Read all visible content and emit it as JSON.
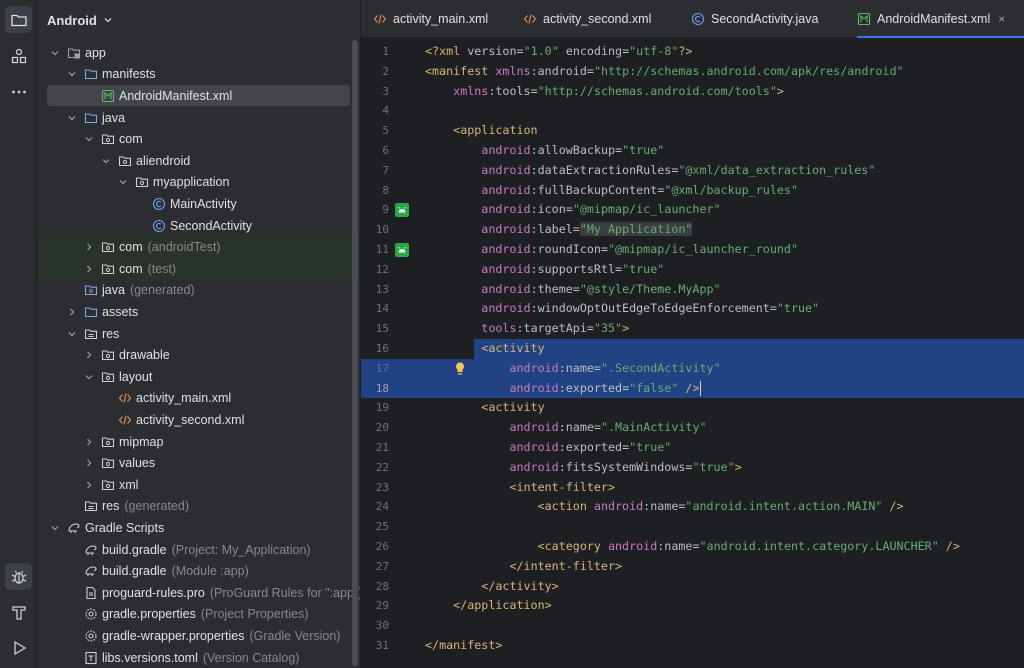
{
  "sidebar": {
    "header_title": "Android",
    "tree": [
      {
        "label": "app",
        "hint": "",
        "depth": 0,
        "arrow": "down",
        "icon": "module-folder-icon"
      },
      {
        "label": "manifests",
        "hint": "",
        "depth": 1,
        "arrow": "down",
        "icon": "folder-icon"
      },
      {
        "label": "AndroidManifest.xml",
        "hint": "",
        "depth": 2,
        "arrow": "none",
        "icon": "manifest-file-icon",
        "selected": true
      },
      {
        "label": "java",
        "hint": "",
        "depth": 1,
        "arrow": "down",
        "icon": "folder-icon"
      },
      {
        "label": "com",
        "hint": "",
        "depth": 2,
        "arrow": "down",
        "icon": "package-icon"
      },
      {
        "label": "aliendroid",
        "hint": "",
        "depth": 3,
        "arrow": "down",
        "icon": "package-icon"
      },
      {
        "label": "myapplication",
        "hint": "",
        "depth": 4,
        "arrow": "down",
        "icon": "package-icon"
      },
      {
        "label": "MainActivity",
        "hint": "",
        "depth": 5,
        "arrow": "none",
        "icon": "class-icon"
      },
      {
        "label": "SecondActivity",
        "hint": "",
        "depth": 5,
        "arrow": "none",
        "icon": "class-icon"
      },
      {
        "label": "com",
        "hint": "(androidTest)",
        "depth": 2,
        "arrow": "right",
        "icon": "package-icon",
        "test": true
      },
      {
        "label": "com",
        "hint": "(test)",
        "depth": 2,
        "arrow": "right",
        "icon": "package-icon",
        "test": true
      },
      {
        "label": "java",
        "hint": "(generated)",
        "depth": 1,
        "arrow": "none",
        "icon": "generated-folder-icon"
      },
      {
        "label": "assets",
        "hint": "",
        "depth": 1,
        "arrow": "right",
        "icon": "folder-icon"
      },
      {
        "label": "res",
        "hint": "",
        "depth": 1,
        "arrow": "down",
        "icon": "res-folder-icon"
      },
      {
        "label": "drawable",
        "hint": "",
        "depth": 2,
        "arrow": "right",
        "icon": "package-icon"
      },
      {
        "label": "layout",
        "hint": "",
        "depth": 2,
        "arrow": "down",
        "icon": "package-icon"
      },
      {
        "label": "activity_main.xml",
        "hint": "",
        "depth": 3,
        "arrow": "none",
        "icon": "xml-file-icon"
      },
      {
        "label": "activity_second.xml",
        "hint": "",
        "depth": 3,
        "arrow": "none",
        "icon": "xml-file-icon"
      },
      {
        "label": "mipmap",
        "hint": "",
        "depth": 2,
        "arrow": "right",
        "icon": "package-icon"
      },
      {
        "label": "values",
        "hint": "",
        "depth": 2,
        "arrow": "right",
        "icon": "package-icon"
      },
      {
        "label": "xml",
        "hint": "",
        "depth": 2,
        "arrow": "right",
        "icon": "package-icon"
      },
      {
        "label": "res",
        "hint": "(generated)",
        "depth": 1,
        "arrow": "none",
        "icon": "res-folder-icon"
      },
      {
        "label": "Gradle Scripts",
        "hint": "",
        "depth": 0,
        "arrow": "down",
        "icon": "gradle-icon"
      },
      {
        "label": "build.gradle",
        "hint": "(Project: My_Application)",
        "depth": 1,
        "arrow": "none",
        "icon": "gradle-icon"
      },
      {
        "label": "build.gradle",
        "hint": "(Module :app)",
        "depth": 1,
        "arrow": "none",
        "icon": "gradle-icon"
      },
      {
        "label": "proguard-rules.pro",
        "hint": "(ProGuard Rules for \":app\")",
        "depth": 1,
        "arrow": "none",
        "icon": "file-icon"
      },
      {
        "label": "gradle.properties",
        "hint": "(Project Properties)",
        "depth": 1,
        "arrow": "none",
        "icon": "settings-file-icon"
      },
      {
        "label": "gradle-wrapper.properties",
        "hint": "(Gradle Version)",
        "depth": 1,
        "arrow": "none",
        "icon": "settings-file-icon"
      },
      {
        "label": "libs.versions.toml",
        "hint": "(Version Catalog)",
        "depth": 1,
        "arrow": "none",
        "icon": "toml-file-icon"
      }
    ]
  },
  "editor": {
    "tabs": [
      {
        "label": "activity_main.xml",
        "icon": "xml-file-icon",
        "active": false
      },
      {
        "label": "activity_second.xml",
        "icon": "xml-file-icon",
        "active": false
      },
      {
        "label": "SecondActivity.java",
        "icon": "class-icon",
        "active": false
      },
      {
        "label": "AndroidManifest.xml",
        "icon": "manifest-file-icon",
        "active": true,
        "close": "×"
      }
    ],
    "current_line": 18,
    "lines": [
      {
        "n": "1",
        "text": "<?xml version=\"1.0\" encoding=\"utf-8\"?>"
      },
      {
        "n": "2",
        "text": "<manifest xmlns:android=\"http://schemas.android.com/apk/res/android\""
      },
      {
        "n": "3",
        "text": "    xmlns:tools=\"http://schemas.android.com/tools\">"
      },
      {
        "n": "4",
        "text": ""
      },
      {
        "n": "5",
        "text": "    <application"
      },
      {
        "n": "6",
        "text": "        android:allowBackup=\"true\""
      },
      {
        "n": "7",
        "text": "        android:dataExtractionRules=\"@xml/data_extraction_rules\""
      },
      {
        "n": "8",
        "text": "        android:fullBackupContent=\"@xml/backup_rules\""
      },
      {
        "n": "9",
        "text": "        android:icon=\"@mipmap/ic_launcher\"",
        "gutter": "android-icon"
      },
      {
        "n": "10",
        "text": "        android:label=\"My Application\""
      },
      {
        "n": "11",
        "text": "        android:roundIcon=\"@mipmap/ic_launcher_round\"",
        "gutter": "android-icon"
      },
      {
        "n": "12",
        "text": "        android:supportsRtl=\"true\""
      },
      {
        "n": "13",
        "text": "        android:theme=\"@style/Theme.MyApp\""
      },
      {
        "n": "14",
        "text": "        android:windowOptOutEdgeToEdgeEnforcement=\"true\""
      },
      {
        "n": "15",
        "text": "        tools:targetApi=\"35\">"
      },
      {
        "n": "16",
        "text": "        <activity",
        "selection": "partial"
      },
      {
        "n": "17",
        "text": "            android:name=\".SecondActivity\"",
        "selection": "full",
        "bulb": true
      },
      {
        "n": "18",
        "text": "            android:exported=\"false\" />",
        "selection": "full",
        "caret": true
      },
      {
        "n": "19",
        "text": "        <activity"
      },
      {
        "n": "20",
        "text": "            android:name=\".MainActivity\""
      },
      {
        "n": "21",
        "text": "            android:exported=\"true\""
      },
      {
        "n": "22",
        "text": "            android:fitsSystemWindows=\"true\">"
      },
      {
        "n": "23",
        "text": "            <intent-filter>"
      },
      {
        "n": "24",
        "text": "                <action android:name=\"android.intent.action.MAIN\" />"
      },
      {
        "n": "25",
        "text": ""
      },
      {
        "n": "26",
        "text": "                <category android:name=\"android.intent.category.LAUNCHER\" />"
      },
      {
        "n": "27",
        "text": "            </intent-filter>"
      },
      {
        "n": "28",
        "text": "        </activity>"
      },
      {
        "n": "29",
        "text": "    </application>"
      },
      {
        "n": "30",
        "text": ""
      },
      {
        "n": "31",
        "text": "</manifest>"
      }
    ]
  },
  "colors": {
    "accent": "#3574f0",
    "selection": "#214283",
    "tag": "#d5b778",
    "namespace": "#c77dbb",
    "string": "#6aab73"
  }
}
